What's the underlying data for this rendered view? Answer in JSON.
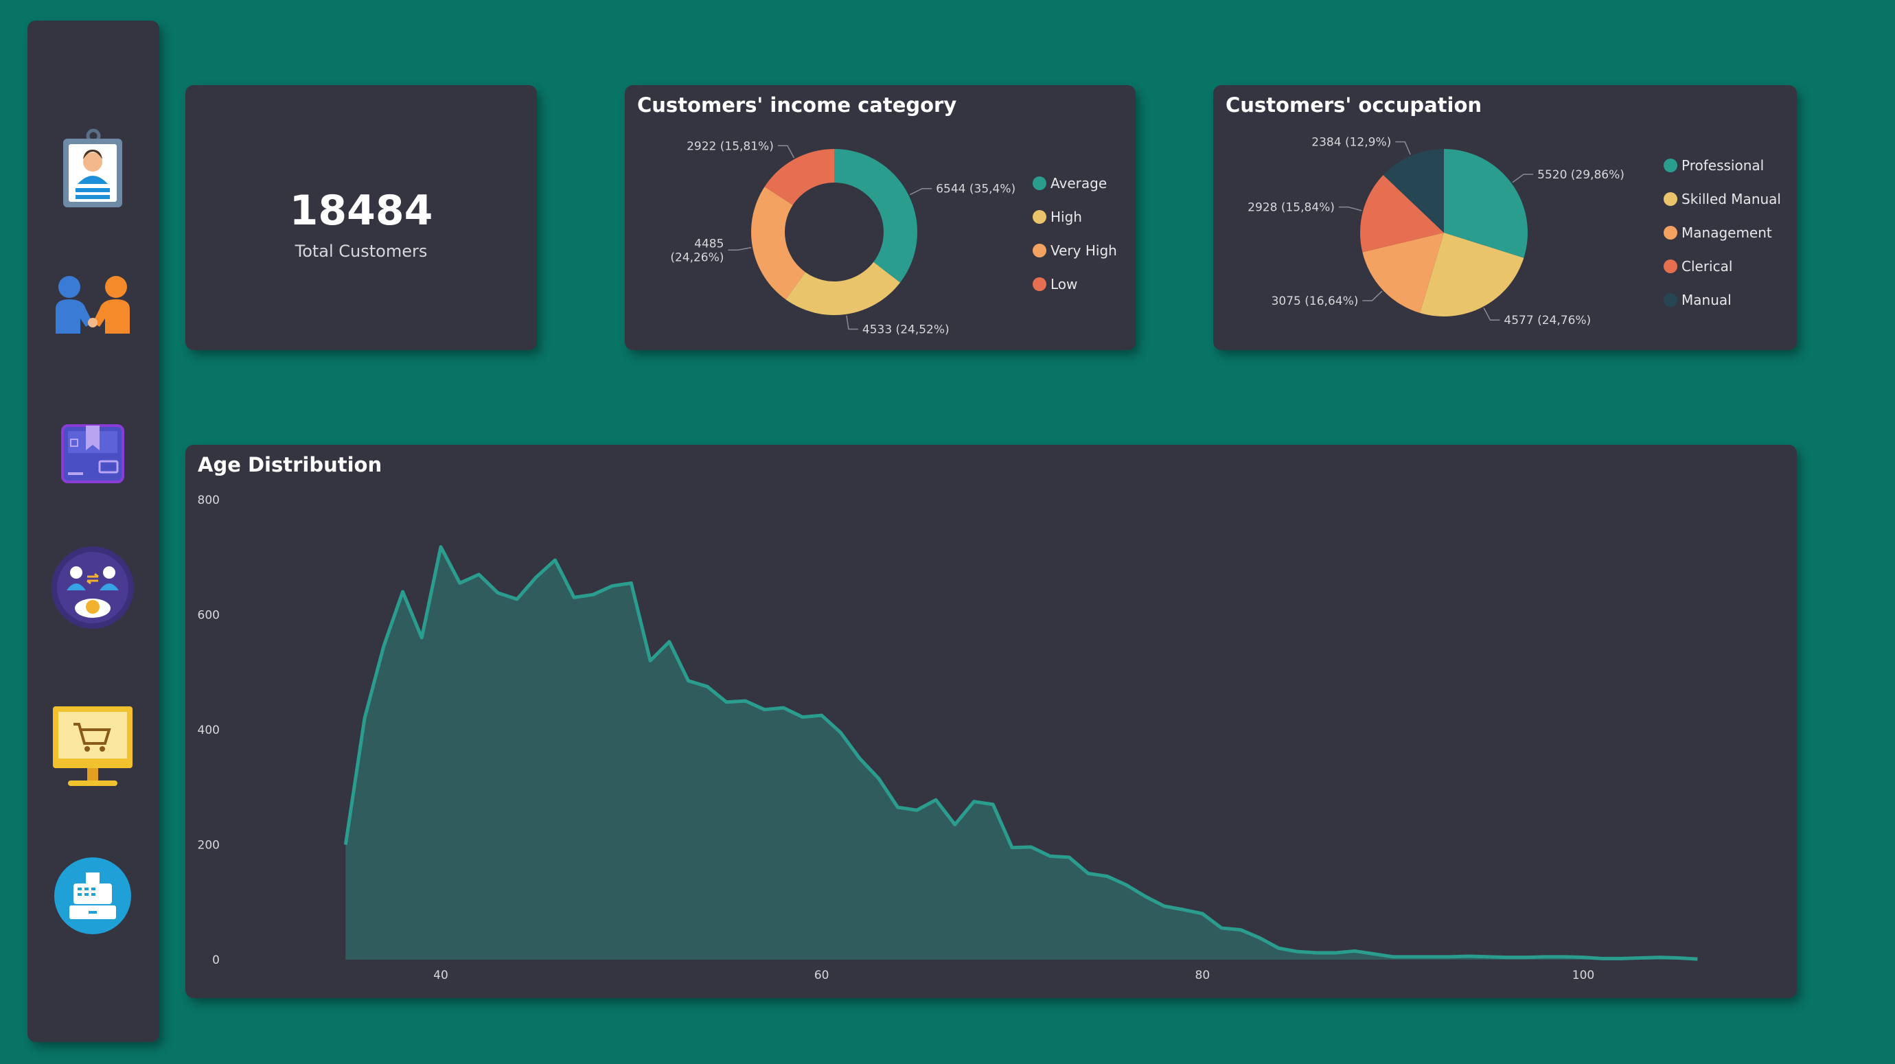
{
  "colors": {
    "background": "#087466",
    "panel": "#343540",
    "teal": "#2a9d8f",
    "yellow": "#e9c46a",
    "orange": "#f4a261",
    "red": "#e76f51",
    "navy": "#264653"
  },
  "sidebar": {
    "items": [
      {
        "icon": "customer-badge-icon"
      },
      {
        "icon": "handshake-icon"
      },
      {
        "icon": "product-box-icon"
      },
      {
        "icon": "customer-exchange-icon"
      },
      {
        "icon": "shopping-cart-monitor-icon"
      },
      {
        "icon": "cash-register-icon"
      }
    ]
  },
  "kpi": {
    "value": "18484",
    "label": "Total Customers"
  },
  "income_chart": {
    "title": "Customers' income category"
  },
  "occupation_chart": {
    "title": "Customers' occupation"
  },
  "age_chart": {
    "title": "Age Distribution"
  },
  "chart_data": [
    {
      "type": "pie",
      "variant": "donut",
      "title": "Customers' income category",
      "legend_position": "right",
      "slices": [
        {
          "name": "Average",
          "value": 6544,
          "label": "6544 (35,4%)",
          "color": "#2a9d8f"
        },
        {
          "name": "High",
          "value": 4533,
          "label": "4533 (24,52%)",
          "color": "#e9c46a"
        },
        {
          "name": "Very High",
          "value": 4485,
          "label": "4485 (24,26%)",
          "color": "#f4a261"
        },
        {
          "name": "Low",
          "value": 2922,
          "label": "2922 (15,81%)",
          "color": "#e76f51"
        }
      ]
    },
    {
      "type": "pie",
      "title": "Customers' occupation",
      "legend_position": "right",
      "slices": [
        {
          "name": "Professional",
          "value": 5520,
          "label": "5520 (29,86%)",
          "color": "#2a9d8f"
        },
        {
          "name": "Skilled Manual",
          "value": 4577,
          "label": "4577 (24,76%)",
          "color": "#e9c46a"
        },
        {
          "name": "Management",
          "value": 3075,
          "label": "3075 (16,64%)",
          "color": "#f4a261"
        },
        {
          "name": "Clerical",
          "value": 2928,
          "label": "2928 (15,84%)",
          "color": "#e76f51"
        },
        {
          "name": "Manual",
          "value": 2384,
          "label": "2384 (12,9%)",
          "color": "#264653"
        }
      ]
    },
    {
      "type": "area",
      "title": "Age Distribution",
      "xlabel": "",
      "ylabel": "",
      "xlim": [
        32,
        107
      ],
      "ylim": [
        0,
        800
      ],
      "x_ticks": [
        40,
        60,
        80,
        100
      ],
      "y_ticks": [
        0,
        200,
        400,
        600,
        800
      ],
      "grid": false,
      "color": "#2a9d8f",
      "x": [
        35,
        36,
        37,
        38,
        39,
        40,
        41,
        42,
        43,
        44,
        45,
        46,
        47,
        48,
        49,
        50,
        51,
        52,
        53,
        54,
        55,
        56,
        57,
        58,
        59,
        60,
        61,
        62,
        63,
        64,
        65,
        66,
        67,
        68,
        69,
        70,
        71,
        72,
        73,
        74,
        75,
        76,
        77,
        78,
        79,
        80,
        81,
        82,
        83,
        84,
        85,
        86,
        87,
        88,
        89,
        90,
        91,
        92,
        93,
        94,
        95,
        96,
        97,
        98,
        99,
        100,
        101,
        102,
        103,
        104,
        105,
        106
      ],
      "y": [
        200,
        420,
        545,
        640,
        560,
        718,
        655,
        670,
        638,
        627,
        665,
        695,
        630,
        635,
        650,
        655,
        520,
        553,
        485,
        475,
        448,
        450,
        435,
        438,
        422,
        425,
        395,
        350,
        315,
        265,
        260,
        278,
        235,
        275,
        270,
        195,
        196,
        180,
        178,
        150,
        145,
        130,
        110,
        93,
        87,
        80,
        55,
        52,
        38,
        20,
        14,
        12,
        12,
        15,
        10,
        5,
        5,
        5,
        5,
        6,
        5,
        4,
        4,
        5,
        5,
        4,
        2,
        2,
        3,
        4,
        3,
        1
      ]
    }
  ]
}
